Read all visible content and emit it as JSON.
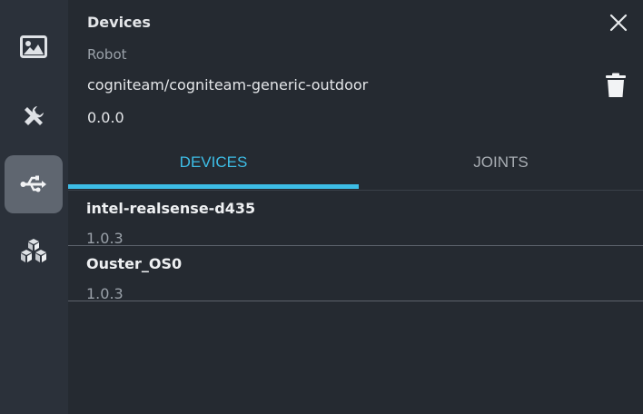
{
  "sidebar": {
    "items": [
      {
        "icon": "image-icon",
        "active": false
      },
      {
        "icon": "tools-icon",
        "active": false
      },
      {
        "icon": "usb-icon",
        "active": true
      },
      {
        "icon": "cubes-icon",
        "active": false
      }
    ]
  },
  "panel": {
    "title": "Devices",
    "label": "Robot",
    "robot_name": "cogniteam/cogniteam-generic-outdoor",
    "robot_version": "0.0.0"
  },
  "tabs": [
    {
      "label": "DEVICES",
      "active": true
    },
    {
      "label": "JOINTS",
      "active": false
    }
  ],
  "devices": [
    {
      "name": "intel-realsense-d435",
      "version": "1.0.3"
    },
    {
      "name": "Ouster_OS0",
      "version": "1.0.3"
    }
  ],
  "colors": {
    "accent": "#3dbde6",
    "background": "#252a31",
    "sidebar": "#2b313a",
    "active_sidebar_item": "#5f6670"
  }
}
